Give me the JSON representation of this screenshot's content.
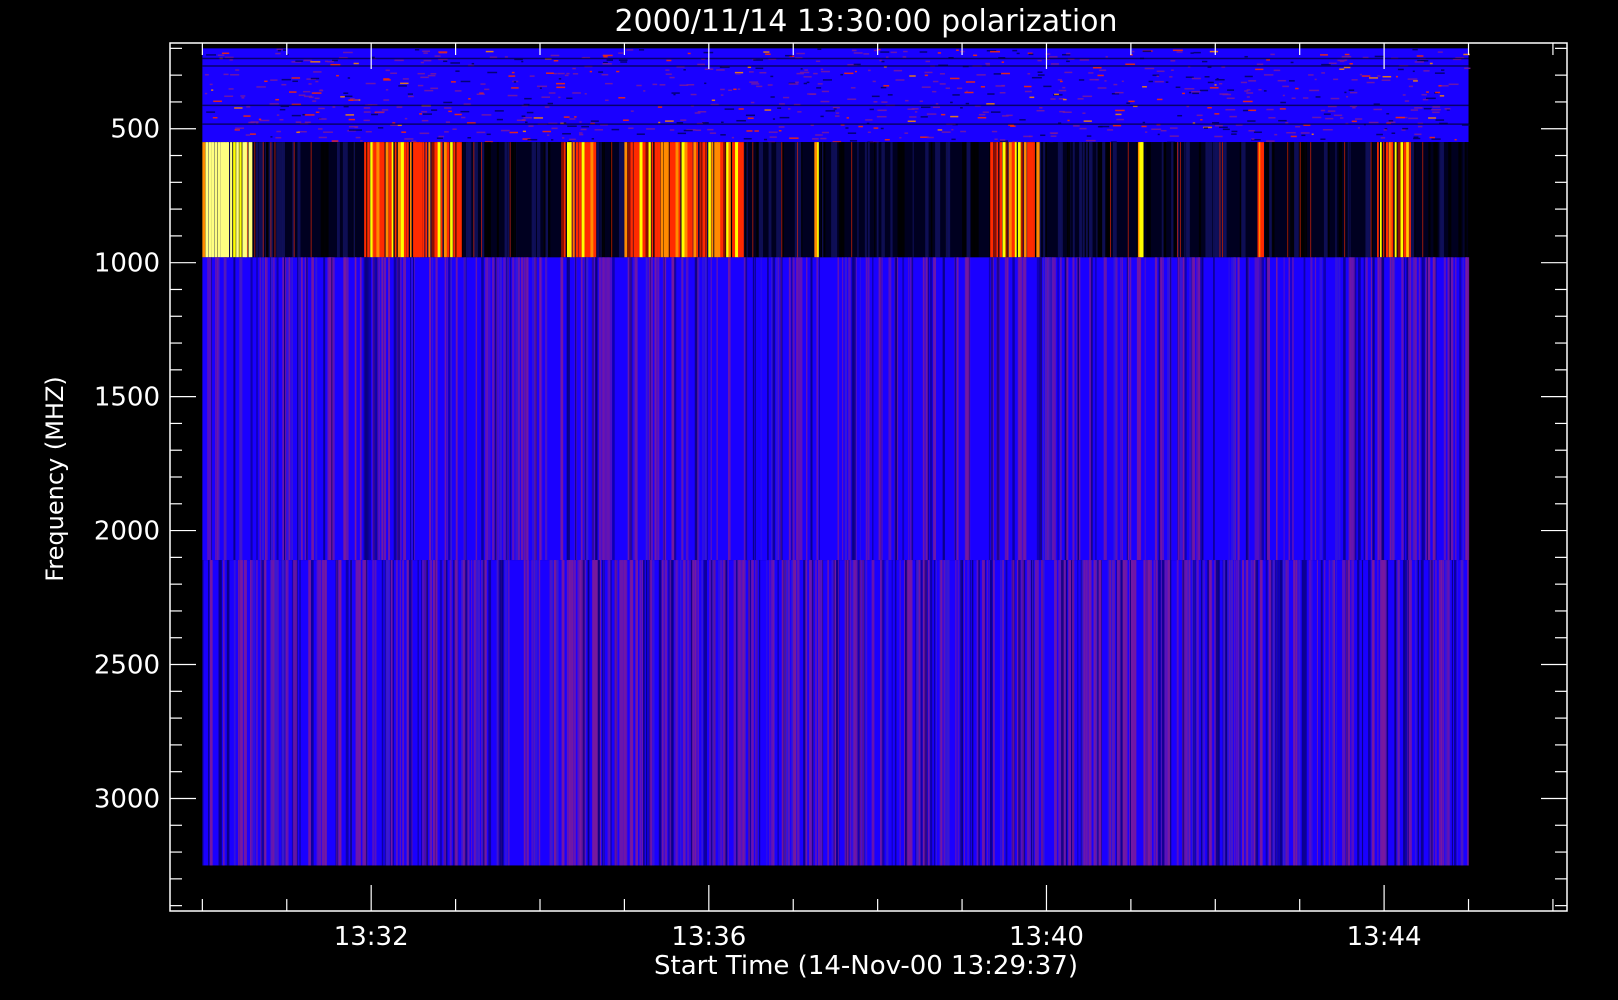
{
  "chart_data": {
    "type": "heatmap",
    "title": "2000/11/14 13:30:00 polarization",
    "xlabel": "Start Time (14-Nov-00 13:29:37)",
    "ylabel": "Frequency (MHZ)",
    "x_range": [
      "13:29:37",
      "13:46:10"
    ],
    "y_range": [
      180,
      3420
    ],
    "y_reversed": true,
    "x_ticks": [
      "13:32",
      "13:36",
      "13:40",
      "13:44"
    ],
    "y_ticks": [
      500,
      1000,
      1500,
      2000,
      2500,
      3000
    ],
    "data_extent": {
      "x": [
        "13:30:00",
        "13:45:00"
      ],
      "y": [
        200,
        3250
      ]
    },
    "bands": [
      {
        "name": "upper",
        "range_mhz": [
          200,
          550
        ],
        "character": "noisy blue/purple with sparse red and yellow speckles"
      },
      {
        "name": "middle",
        "range_mhz": [
          550,
          980
        ],
        "character": "dark blue background with bright red, orange and yellow vertical bursts",
        "strong_bursts": [
          "13:30:00-13:30:35",
          "13:31:55-13:32:45",
          "13:32:45-13:33:05",
          "13:34:15-13:34:40",
          "13:35:00-13:35:30",
          "13:35:30-13:36:25",
          "13:37:15",
          "13:39:20-13:39:55",
          "13:41:05",
          "13:42:30",
          "13:43:55-13:44:20"
        ]
      },
      {
        "name": "lower-1",
        "range_mhz": [
          980,
          2110
        ],
        "character": "uniform blue with faint vertical purple streaks"
      },
      {
        "name": "lower-2",
        "range_mhz": [
          2110,
          3250
        ],
        "character": "blue with denser purple vertical streaks"
      }
    ],
    "colors": {
      "background": "#000000",
      "low": "#1a00ff",
      "mid": "#7a1a9c",
      "dark": "#000020",
      "red": "#ff2a00",
      "orange": "#ff8a00",
      "yellow": "#ffff80"
    },
    "grid": false,
    "legend": "none"
  }
}
